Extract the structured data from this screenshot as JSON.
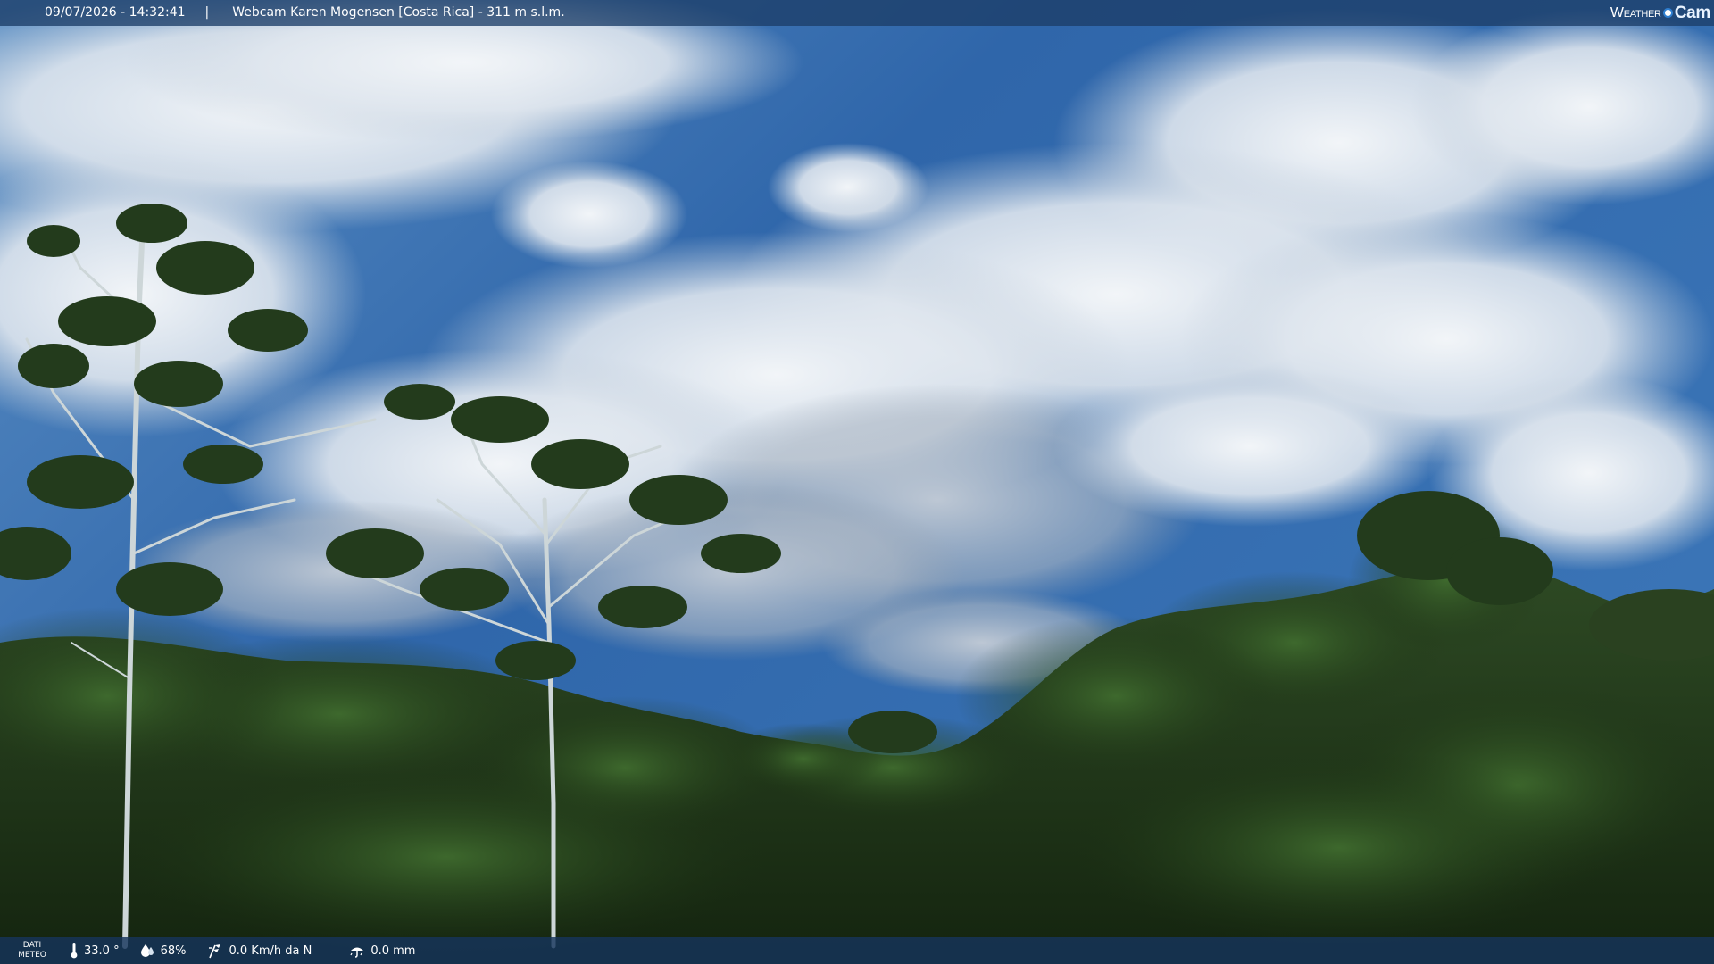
{
  "header": {
    "datetime": "09/07/2026 - 14:32:41",
    "separator": "|",
    "camera_title": "Webcam Karen Mogensen [Costa Rica]  - 311 m s.l.m."
  },
  "brand": {
    "part1": "Weather",
    "part2": "Cam"
  },
  "footer": {
    "dati_line1": "DATI",
    "dati_line2": "METEO",
    "temperature": "33.0 °",
    "humidity": "68%",
    "wind": "0.0 Km/h da N",
    "rain": "0.0 mm"
  },
  "colors": {
    "sky": "#3a6fb0",
    "cloud": "#e6ecf2",
    "forest": "#223a1a",
    "bar": "#1c3e68"
  },
  "icons": {
    "temperature": "thermometer-icon",
    "humidity": "droplet-icon",
    "wind": "wind-icon",
    "rain": "rain-icon"
  }
}
